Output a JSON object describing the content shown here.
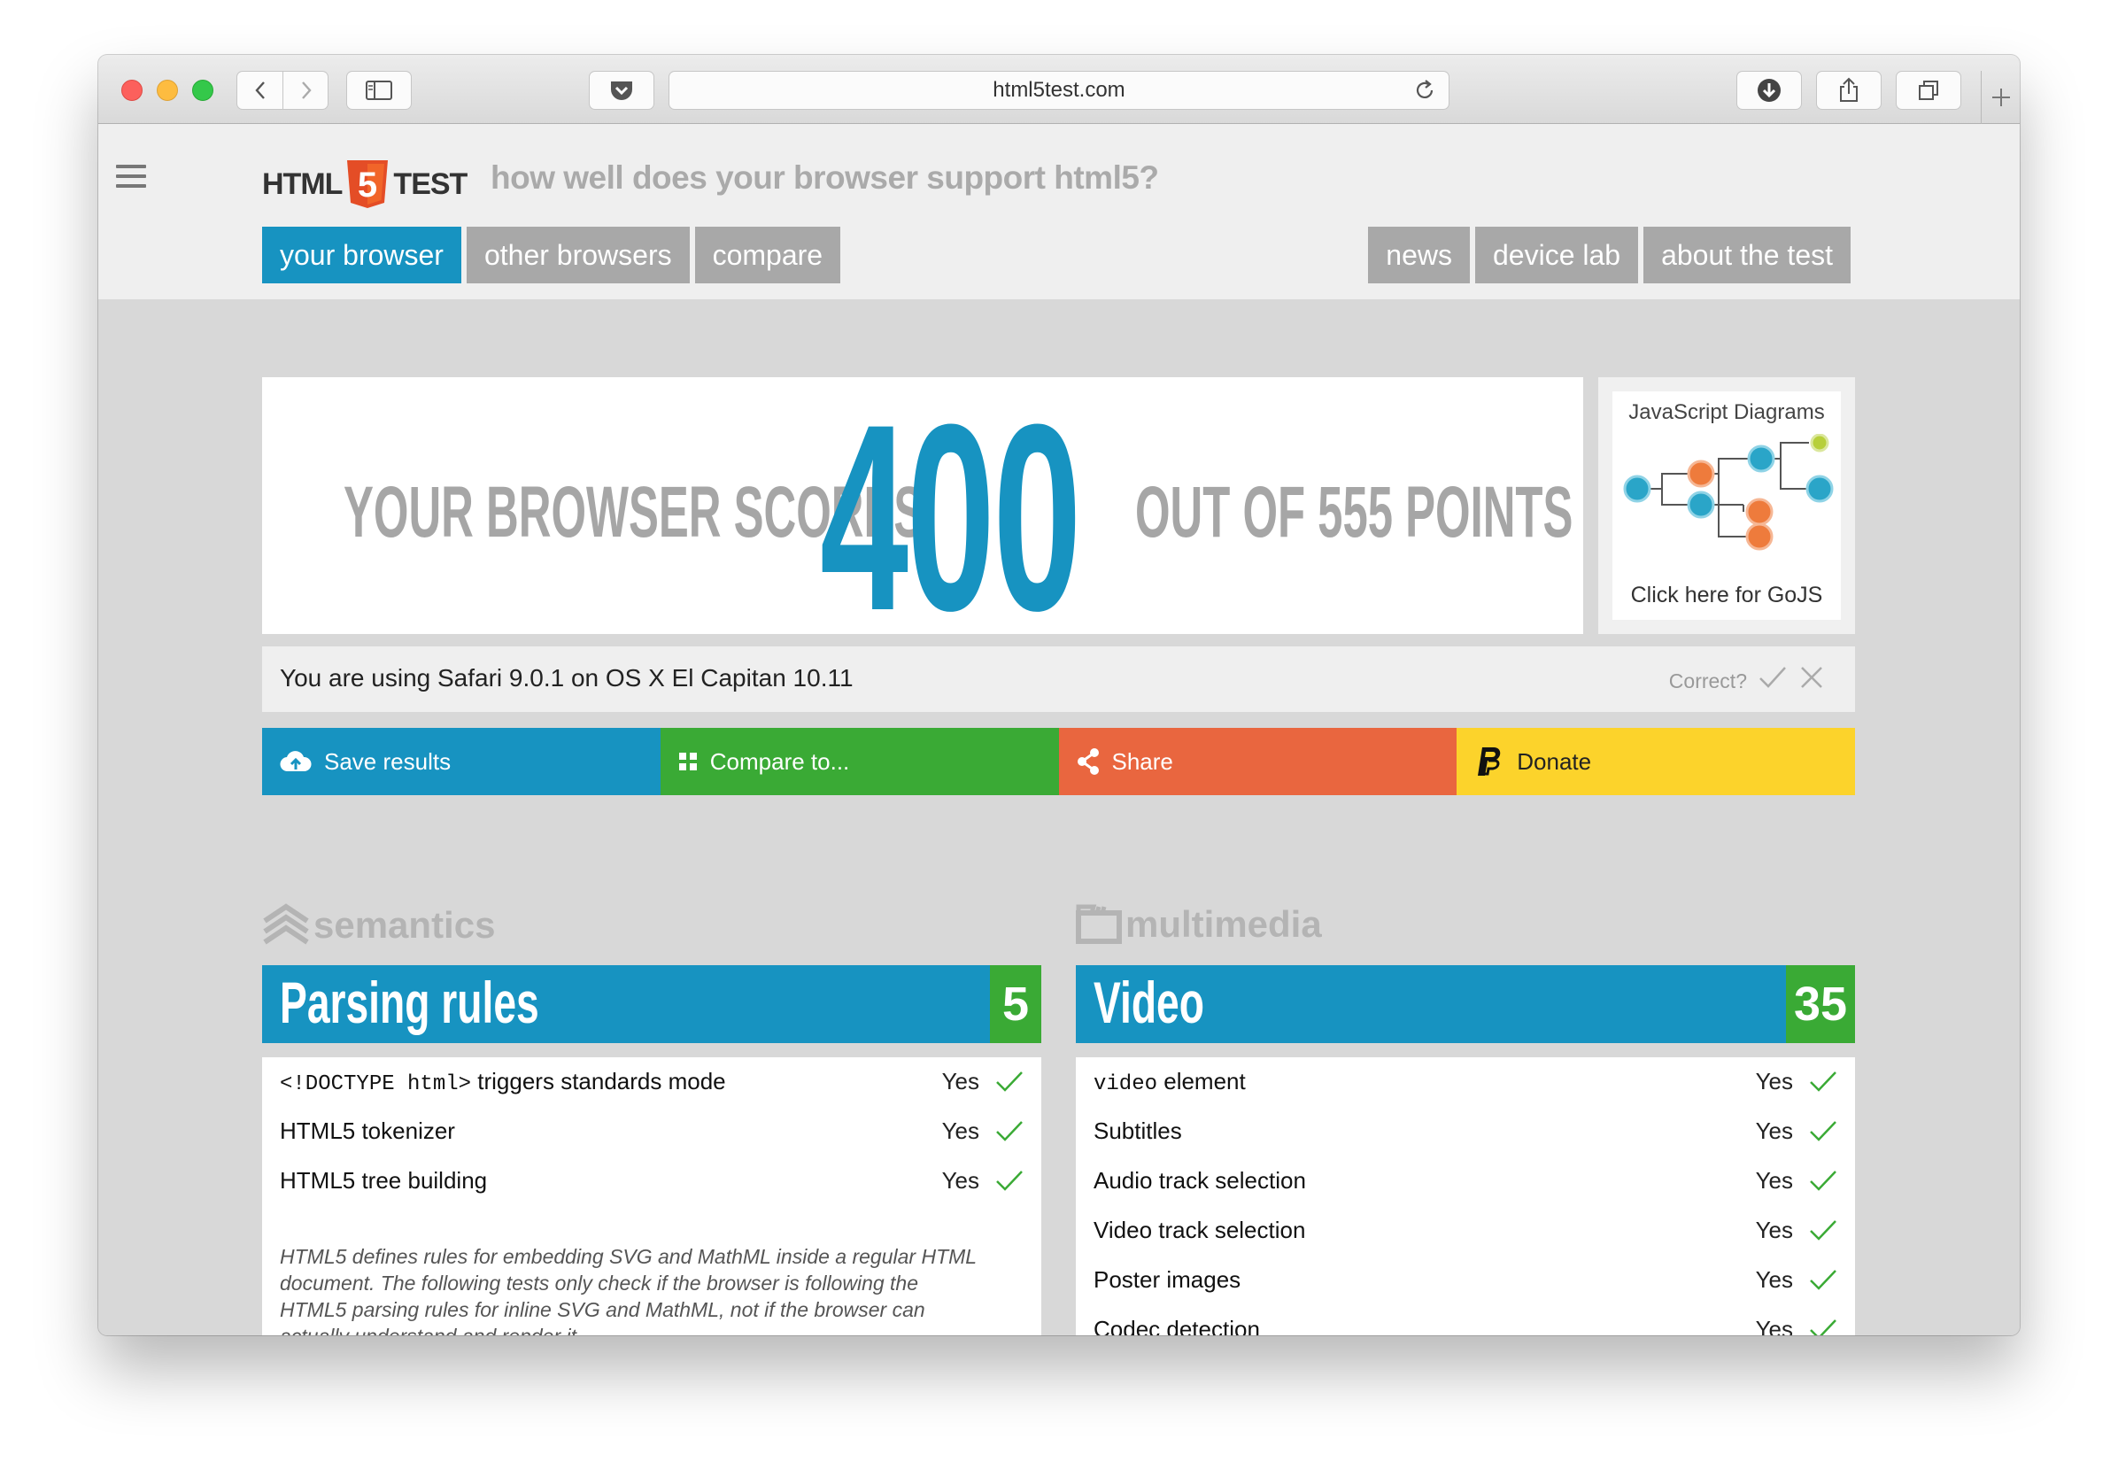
{
  "browser": {
    "url": "html5test.com",
    "nav_back_icon": "chevron-left",
    "nav_forward_icon": "chevron-right"
  },
  "site": {
    "logo_left": "HTML",
    "logo_mid": "5",
    "logo_right": "TEST",
    "tagline": "how well does your browser support html5?",
    "tabs_left": [
      "your browser",
      "other browsers",
      "compare"
    ],
    "tabs_right": [
      "news",
      "device lab",
      "about the test"
    ]
  },
  "score": {
    "prefix": "YOUR BROWSER SCORES",
    "value": "400",
    "suffix": "OUT OF 555 POINTS"
  },
  "ad": {
    "title": "JavaScript Diagrams",
    "cta": "Click here for GoJS"
  },
  "ua": {
    "text": "You are using Safari 9.0.1 on OS X El Capitan 10.11",
    "correct_label": "Correct?"
  },
  "actions": {
    "save": "Save results",
    "compare": "Compare to...",
    "share": "Share",
    "donate": "Donate"
  },
  "colors": {
    "blue": "#1793c1",
    "green": "#3aaa35",
    "orange": "#e9663f",
    "yellow": "#fcd32b"
  },
  "semantics": {
    "category": "semantics",
    "section_title": "Parsing rules",
    "points": "5",
    "rows": [
      {
        "code": "<!DOCTYPE html>",
        "label": " triggers standards mode",
        "result": "Yes"
      },
      {
        "code": "",
        "label": "HTML5 tokenizer",
        "result": "Yes"
      },
      {
        "code": "",
        "label": "HTML5 tree building",
        "result": "Yes"
      }
    ],
    "note": "HTML5 defines rules for embedding SVG and MathML inside a regular HTML document. The following tests only check if the browser is following the HTML5 parsing rules for inline SVG and MathML, not if the browser can actually understand and render it."
  },
  "multimedia": {
    "category": "multimedia",
    "section_title": "Video",
    "points": "35",
    "rows": [
      {
        "code": "video",
        "label": " element",
        "result": "Yes"
      },
      {
        "code": "",
        "label": "Subtitles",
        "result": "Yes"
      },
      {
        "code": "",
        "label": "Audio track selection",
        "result": "Yes"
      },
      {
        "code": "",
        "label": "Video track selection",
        "result": "Yes"
      },
      {
        "code": "",
        "label": "Poster images",
        "result": "Yes"
      },
      {
        "code": "",
        "label": "Codec detection",
        "result": "Yes"
      }
    ]
  }
}
